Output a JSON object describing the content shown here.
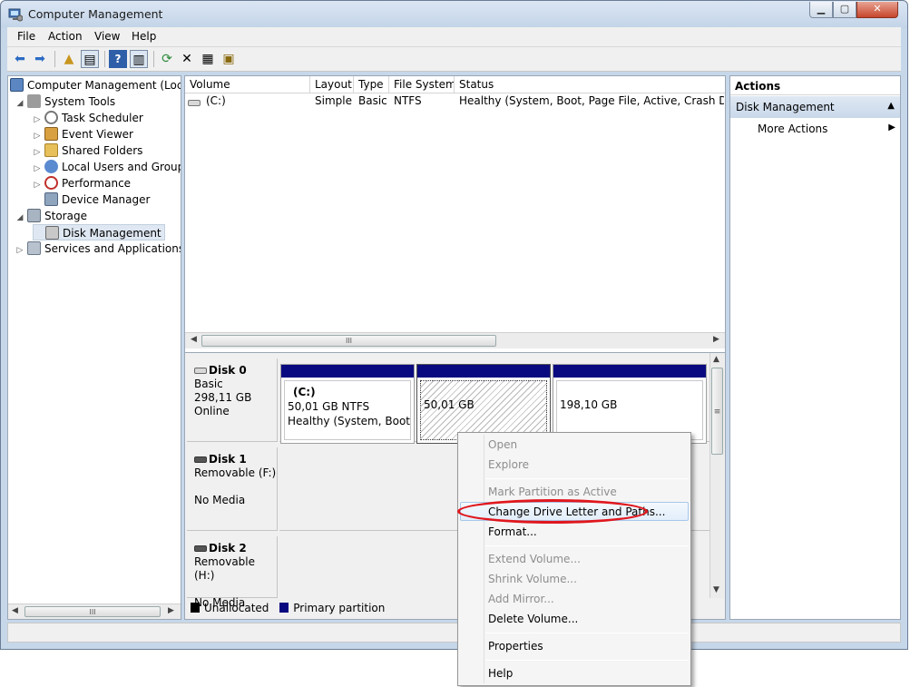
{
  "window": {
    "title": "Computer Management",
    "buttons": {
      "minimize": "▁",
      "maximize": "▢",
      "close": "✕"
    }
  },
  "menubar": {
    "items": [
      "File",
      "Action",
      "View",
      "Help"
    ]
  },
  "toolbar": {
    "icons": [
      "back-arrow-icon",
      "forward-arrow-icon",
      "up-folder-icon",
      "show-hide-tree-icon",
      "help-icon",
      "show-hide-action-pane-icon",
      "refresh-icon",
      "delete-icon",
      "properties-icon",
      "export-icon"
    ]
  },
  "tree": {
    "items": [
      {
        "label": "Computer Management (Local",
        "expander": "",
        "icon": "computer-icon"
      },
      {
        "label": "System Tools",
        "expander": "◢",
        "icon": "tools-icon"
      },
      {
        "label": "Task Scheduler",
        "expander": "▷",
        "icon": "clock-icon"
      },
      {
        "label": "Event Viewer",
        "expander": "▷",
        "icon": "event-viewer-icon"
      },
      {
        "label": "Shared Folders",
        "expander": "▷",
        "icon": "shared-folder-icon"
      },
      {
        "label": "Local Users and Groups",
        "expander": "▷",
        "icon": "users-icon"
      },
      {
        "label": "Performance",
        "expander": "▷",
        "icon": "performance-icon"
      },
      {
        "label": "Device Manager",
        "expander": "",
        "icon": "device-manager-icon"
      },
      {
        "label": "Storage",
        "expander": "◢",
        "icon": "storage-icon"
      },
      {
        "label": "Disk Management",
        "expander": "",
        "icon": "disk-management-icon"
      },
      {
        "label": "Services and Applications",
        "expander": "▷",
        "icon": "services-icon"
      }
    ],
    "scroll_grip": "III"
  },
  "volumes": {
    "columns": [
      "Volume",
      "Layout",
      "Type",
      "File System",
      "Status"
    ],
    "rows": [
      {
        "volume": "(C:)",
        "layout": "Simple",
        "type": "Basic",
        "fs": "NTFS",
        "status": "Healthy (System, Boot, Page File, Active, Crash Dump, P"
      }
    ],
    "scroll_grip": "III"
  },
  "disks": [
    {
      "name": "Disk 0",
      "line1": "Basic",
      "line2": "298,11 GB",
      "line3": "Online",
      "partitions": [
        {
          "name": "(C:)",
          "size": "50,01 GB NTFS",
          "status": "Healthy (System, Boot, Pa"
        },
        {
          "name": "",
          "size": "50,01 GB",
          "status": ""
        },
        {
          "name": "",
          "size": "198,10 GB",
          "status": ""
        }
      ]
    },
    {
      "name": "Disk 1",
      "line1": "Removable (F:)",
      "line2": "",
      "line3": "No Media"
    },
    {
      "name": "Disk 2",
      "line1": "Removable (H:)",
      "line2": "",
      "line3": "No Media"
    }
  ],
  "legend": [
    {
      "label": "Unallocated",
      "color": "#000000"
    },
    {
      "label": "Primary partition",
      "color": "#0a0a80"
    }
  ],
  "actions": {
    "header": "Actions",
    "section": "Disk Management",
    "more": "More Actions"
  },
  "context_menu": {
    "items": [
      {
        "label": "Open",
        "enabled": false
      },
      {
        "label": "Explore",
        "enabled": false
      },
      {
        "label": "Mark Partition as Active",
        "enabled": false
      },
      {
        "label": "Change Drive Letter and Paths...",
        "enabled": true,
        "highlighted": true
      },
      {
        "label": "Format...",
        "enabled": true
      },
      {
        "label": "Extend Volume...",
        "enabled": false
      },
      {
        "label": "Shrink Volume...",
        "enabled": false
      },
      {
        "label": "Add Mirror...",
        "enabled": false
      },
      {
        "label": "Delete Volume...",
        "enabled": true
      },
      {
        "label": "Properties",
        "enabled": true
      },
      {
        "label": "Help",
        "enabled": true
      }
    ]
  },
  "colors": {
    "annotation_circle": "#e0171d",
    "primary_partition": "#0a0a80",
    "selection": "#c9d8ea"
  }
}
